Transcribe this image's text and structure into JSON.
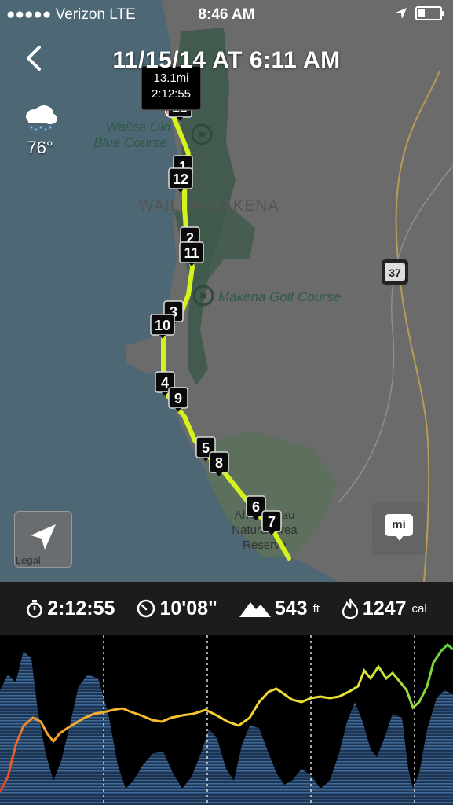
{
  "status_bar": {
    "carrier": "●●●●● Verizon  LTE",
    "time": "8:46 AM"
  },
  "header": {
    "title": "11/15/14 AT 6:11 AM"
  },
  "weather": {
    "icon": "rain-cloud-icon",
    "temperature": "76°"
  },
  "map": {
    "labels": {
      "wailea_course": "Wailea Old Blue Course",
      "wailea_makena": "WAILEA-MAKENA",
      "makena_golf": "Makena Golf Course",
      "reserve": "Ahihi-Kinau Natural Area Reserve",
      "highway": "37"
    },
    "finish_popup": {
      "distance": "13.1mi",
      "duration": "2:12:55"
    },
    "markers": [
      "1",
      "2",
      "3",
      "4",
      "5",
      "6",
      "7",
      "8",
      "9",
      "10",
      "11",
      "12",
      "13"
    ],
    "route_color": "#d6f21c",
    "legal": "Legal"
  },
  "unit_toggle": "mi",
  "stats": {
    "duration": "2:12:55",
    "pace": "10'08\"",
    "elevation": "543",
    "elevation_unit": "ft",
    "calories": "1247",
    "calories_unit": "cal"
  },
  "colors": {
    "water": "#4d6775",
    "land": "#6b6b6b",
    "park": "#3e5a4b",
    "route": "#d6f21c",
    "elevation_fill": "#2b4a6e",
    "pace_slow": "#e0392a",
    "pace_mid": "#f5b82e",
    "pace_fast": "#5fd13a"
  }
}
